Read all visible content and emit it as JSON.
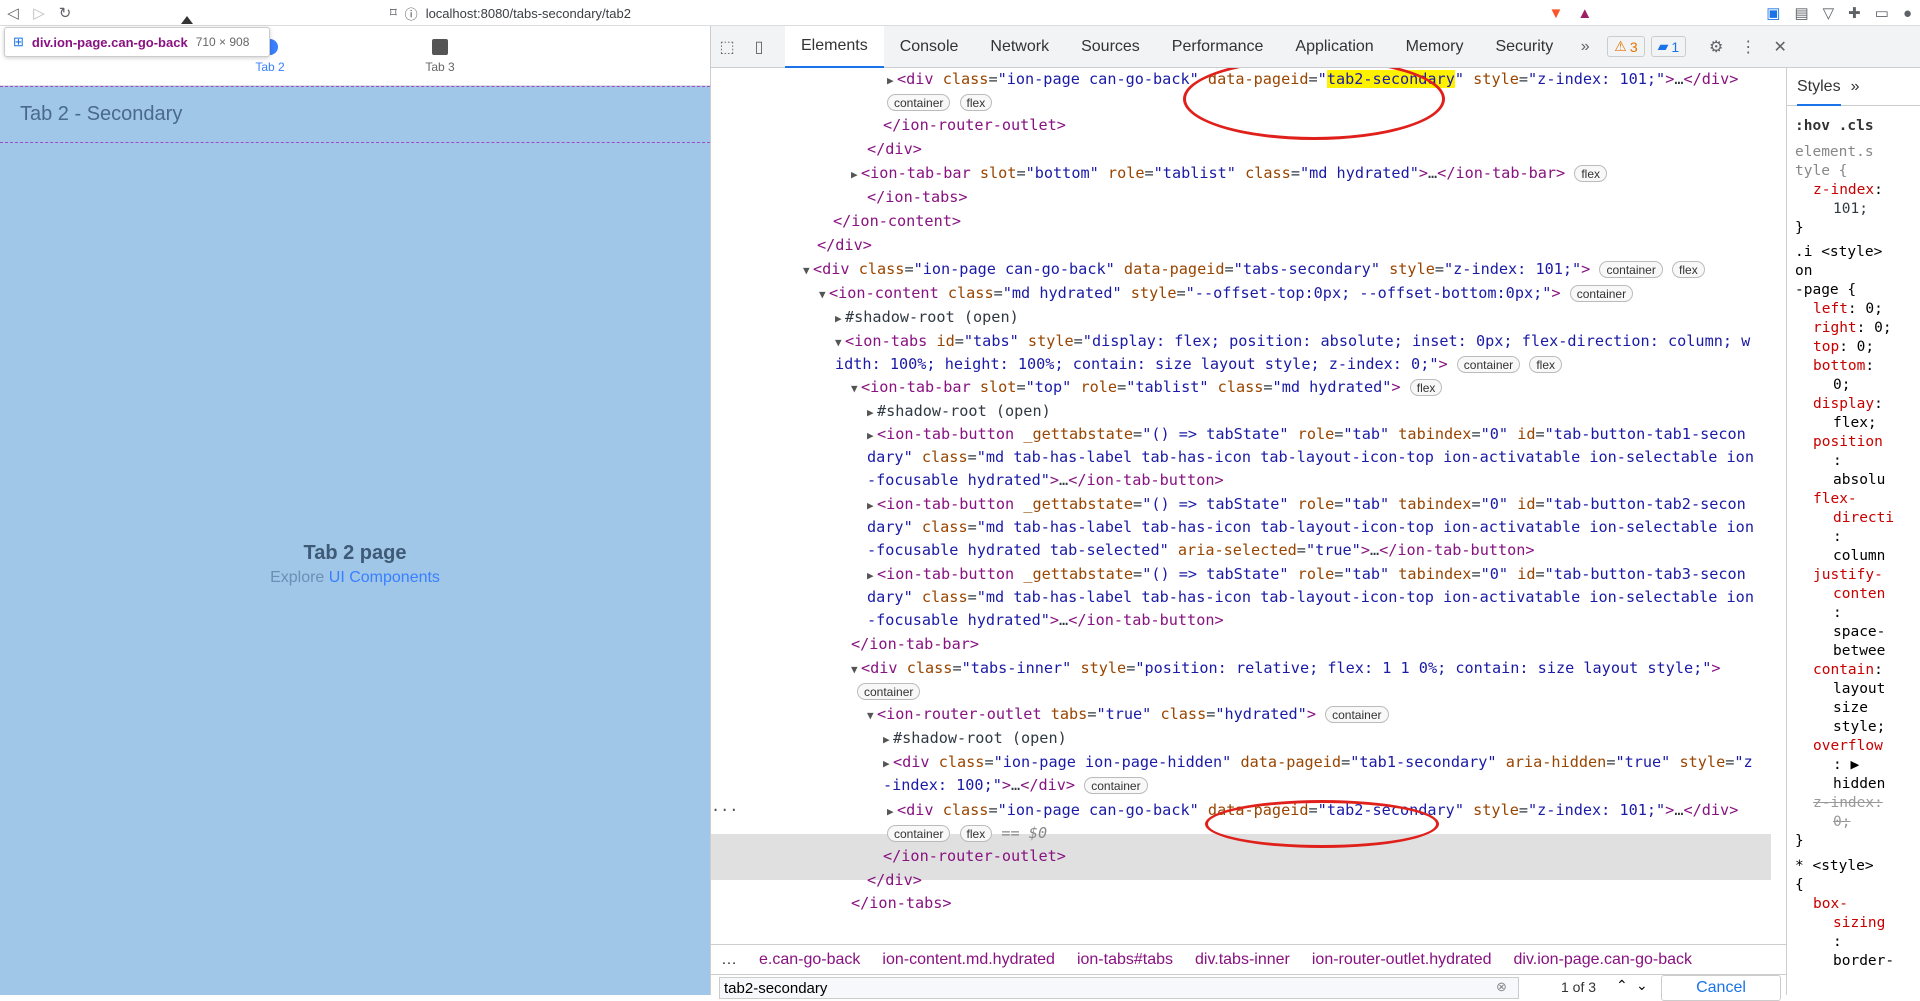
{
  "browser": {
    "url": "localhost:8080/tabs-secondary/tab2"
  },
  "app": {
    "tabs": [
      {
        "label": "Tab 2",
        "selected": true
      },
      {
        "label": "Tab 3",
        "selected": false
      }
    ],
    "page_title": "Tab 2 - Secondary",
    "center_title": "Tab 2 page",
    "center_sub_prefix": "Explore",
    "center_sub_link": "UI Components",
    "inspect_tooltip": {
      "selector": "div.ion-page.can-go-back",
      "dims": "710 × 908"
    }
  },
  "devtools": {
    "tabs": [
      "Elements",
      "Console",
      "Network",
      "Sources",
      "Performance",
      "Application",
      "Memory",
      "Security"
    ],
    "warn_count": "3",
    "info_count": "1",
    "breadcrumbs": [
      "e.can-go-back",
      "ion-content.md.hydrated",
      "ion-tabs#tabs",
      "div.tabs-inner",
      "ion-router-outlet.hydrated",
      "div.ion-page.can-go-back"
    ],
    "search_value": "tab2-secondary",
    "search_count": "1 of 3",
    "cancel_label": "Cancel",
    "styles_label": "Styles",
    "hov_label": ":hov",
    "cls_label": ".cls"
  }
}
